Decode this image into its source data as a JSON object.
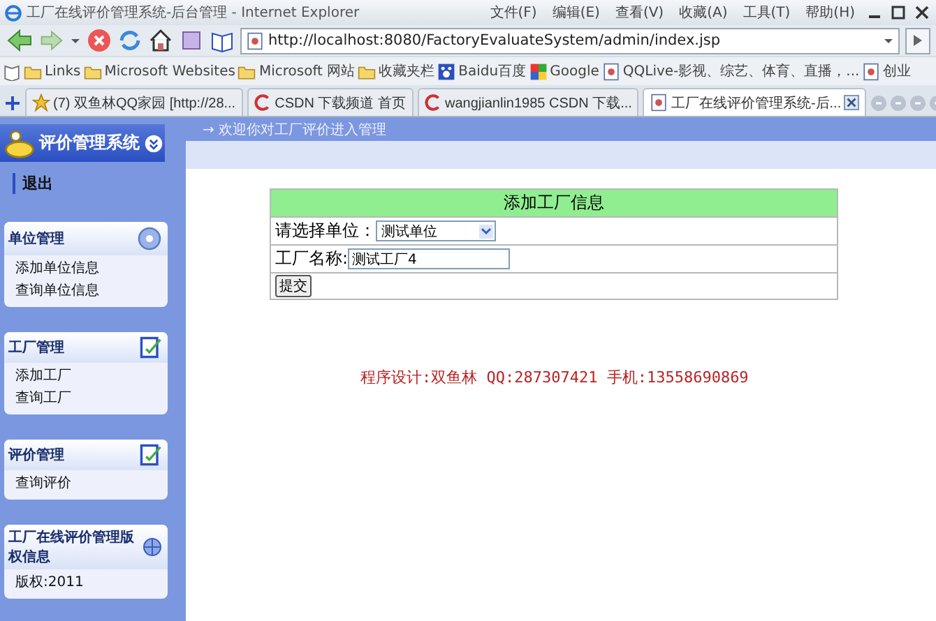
{
  "window": {
    "title": "工厂在线评价管理系统-后台管理 - Internet Explorer",
    "menu": [
      "文件(F)",
      "编辑(E)",
      "查看(V)",
      "收藏(A)",
      "工具(T)",
      "帮助(H)"
    ]
  },
  "address": {
    "value": "http://localhost:8080/FactoryEvaluateSystem/admin/index.jsp"
  },
  "favorites": [
    {
      "label": "Links",
      "kind": "folder"
    },
    {
      "label": "Microsoft Websites",
      "kind": "folder"
    },
    {
      "label": "Microsoft 网站",
      "kind": "folder"
    },
    {
      "label": "收藏夹栏",
      "kind": "folder"
    },
    {
      "label": "Baidu百度",
      "kind": "paw"
    },
    {
      "label": "Google",
      "kind": "google"
    },
    {
      "label": "QQLive-影视、综艺、体育、直播，...",
      "kind": "page"
    },
    {
      "label": "创业",
      "kind": "page"
    }
  ],
  "tabs": [
    {
      "label": "(7) 双鱼林QQ家园 [http://28...",
      "kind": "star",
      "selected": false
    },
    {
      "label": "CSDN 下载频道 首页",
      "kind": "csdn",
      "selected": false
    },
    {
      "label": "wangjianlin1985 CSDN 下载...",
      "kind": "csdn",
      "selected": false
    },
    {
      "label": "工厂在线评价管理系统-后...",
      "kind": "page",
      "selected": true
    }
  ],
  "sidebar": {
    "title": "评价管理系统",
    "logout": "退出",
    "sections": [
      {
        "title": "单位管理",
        "kind": "gear",
        "items": [
          "添加单位信息",
          "查询单位信息"
        ]
      },
      {
        "title": "工厂管理",
        "kind": "note",
        "items": [
          "添加工厂",
          "查询工厂"
        ]
      },
      {
        "title": "评价管理",
        "kind": "note",
        "items": [
          "查询评价"
        ]
      },
      {
        "title": "工厂在线评价管理版权信息",
        "kind": "globe",
        "items": [
          "版权:2011"
        ]
      }
    ]
  },
  "welcome": "→ 欢迎你对工厂评价进入管理",
  "form": {
    "title": "添加工厂信息",
    "unit_label": "请选择单位：",
    "unit_value": "测试单位",
    "name_label": "工厂名称:",
    "name_value": "测试工厂4",
    "submit": "提交"
  },
  "credit": "程序设计:双鱼林 QQ:287307421 手机:13558690869"
}
